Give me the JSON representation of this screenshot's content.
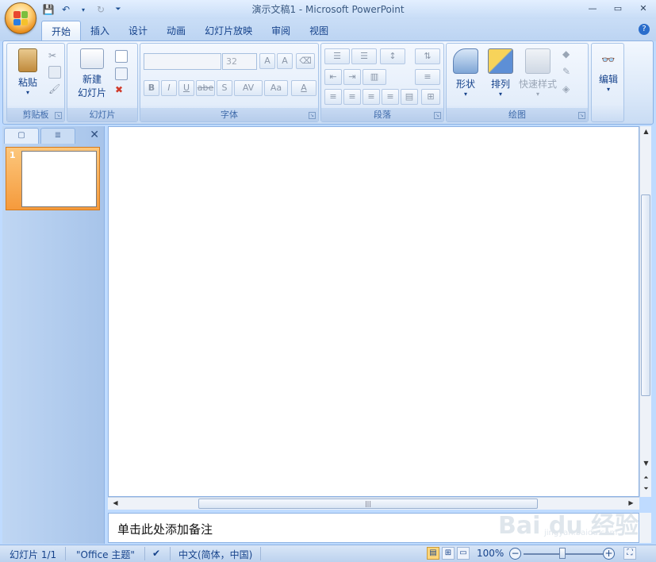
{
  "window": {
    "title": "演示文稿1 - Microsoft PowerPoint",
    "minimize": "—",
    "maximize": "▭",
    "close": "✕"
  },
  "qat": {
    "save_icon": "save-icon",
    "undo_icon": "undo-icon",
    "redo_icon": "redo-icon",
    "customize": "⏷"
  },
  "tabs": [
    {
      "label": "开始"
    },
    {
      "label": "插入"
    },
    {
      "label": "设计"
    },
    {
      "label": "动画"
    },
    {
      "label": "幻灯片放映"
    },
    {
      "label": "审阅"
    },
    {
      "label": "视图"
    }
  ],
  "help": "?",
  "ribbon": {
    "clipboard": {
      "label": "剪贴板",
      "paste": "粘贴"
    },
    "slides": {
      "label": "幻灯片",
      "new_slide_1": "新建",
      "new_slide_2": "幻灯片"
    },
    "font": {
      "label": "字体",
      "font_name": "",
      "font_size": "32",
      "bold": "B",
      "italic": "I",
      "underline": "U",
      "strike": "abe",
      "shadow": "S",
      "spacing": "AV",
      "case": "Aa",
      "color": "A",
      "grow": "A",
      "shrink": "A"
    },
    "paragraph": {
      "label": "段落"
    },
    "drawing": {
      "label": "绘图",
      "shapes": "形状",
      "arrange": "排列",
      "quick_styles": "快速样式"
    },
    "editing": {
      "label": "编辑"
    }
  },
  "left_panel": {
    "slide_number": "1",
    "close": "✕"
  },
  "notes": {
    "placeholder": "单击此处添加备注"
  },
  "status": {
    "slide": "幻灯片 1/1",
    "theme": "\"Office 主题\"",
    "language": "中文(简体，中国)",
    "zoom": "100%"
  },
  "watermark": {
    "text": "Bai du 经验",
    "sub": "jingyan.baidu.com"
  },
  "colors": {
    "accent": "#15428b",
    "selection": "#f59a3c",
    "ribbon": "#dce9f9"
  }
}
